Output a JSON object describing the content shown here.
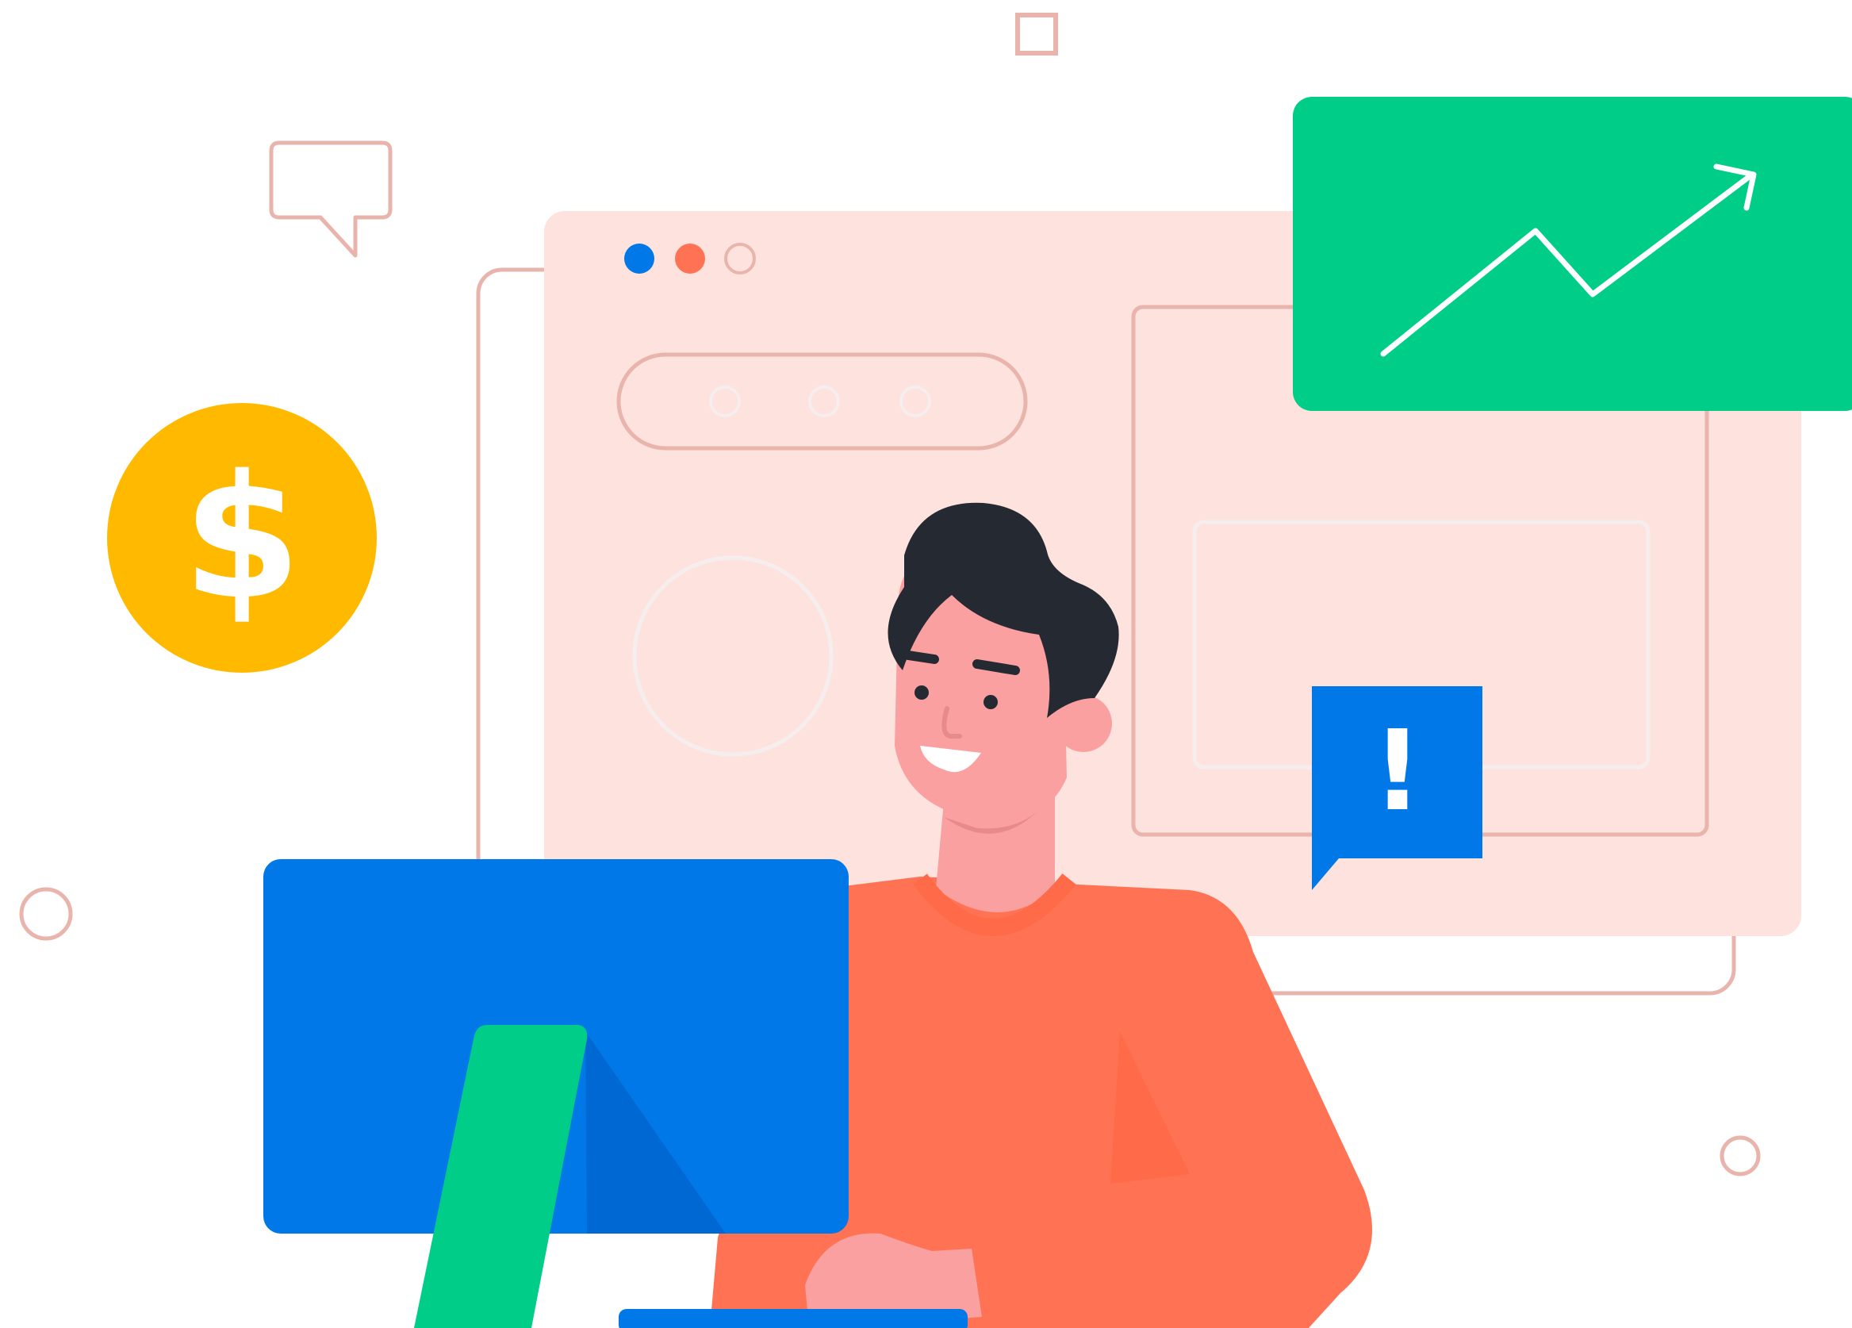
{
  "coin": {
    "symbol": "$"
  },
  "alert": {
    "symbol": "!"
  },
  "colors": {
    "panel_fill": "#fde2dd",
    "outline": "#e8b4ac",
    "light_outline": "#f6eeee",
    "blue": "#0078e8",
    "blue_dark": "#0068d2",
    "orange": "#ff7354",
    "orange_dark": "#ff6a48",
    "green": "#00ce88",
    "coin": "#ffba00",
    "skin": "#fba0a1",
    "skin_shadow": "#e8898b",
    "hair": "#252932",
    "white": "#ffffff"
  },
  "icons": {
    "coin": "dollar-coin-icon",
    "alert": "exclamation-alert-icon",
    "trend": "trend-arrow-icon",
    "speech": "speech-bubble-icon",
    "window_dots": "window-control-dots-icon"
  }
}
